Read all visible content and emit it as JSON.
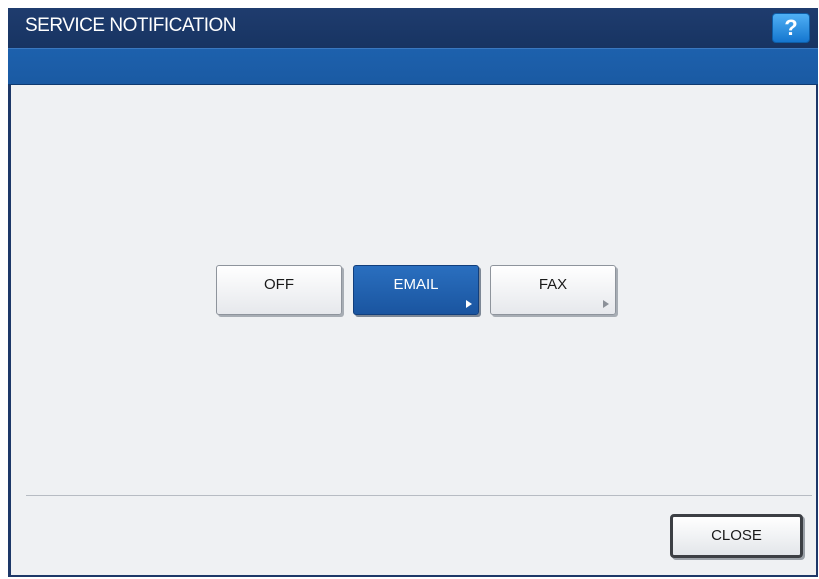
{
  "window": {
    "title": "SERVICE NOTIFICATION",
    "help_label": "?"
  },
  "options": [
    {
      "label": "OFF",
      "selected": false
    },
    {
      "label": "EMAIL",
      "selected": true
    },
    {
      "label": "FAX",
      "selected": false
    }
  ],
  "footer": {
    "close_label": "CLOSE"
  },
  "colors": {
    "titlebar": "#1f3c6e",
    "subbar": "#1d61ad",
    "selected_button": "#1a55a0",
    "help_button": "#1576cf",
    "background": "#eff1f3"
  },
  "icons": {
    "help": "question-mark-icon",
    "submenu": "triangle-right-icon"
  }
}
